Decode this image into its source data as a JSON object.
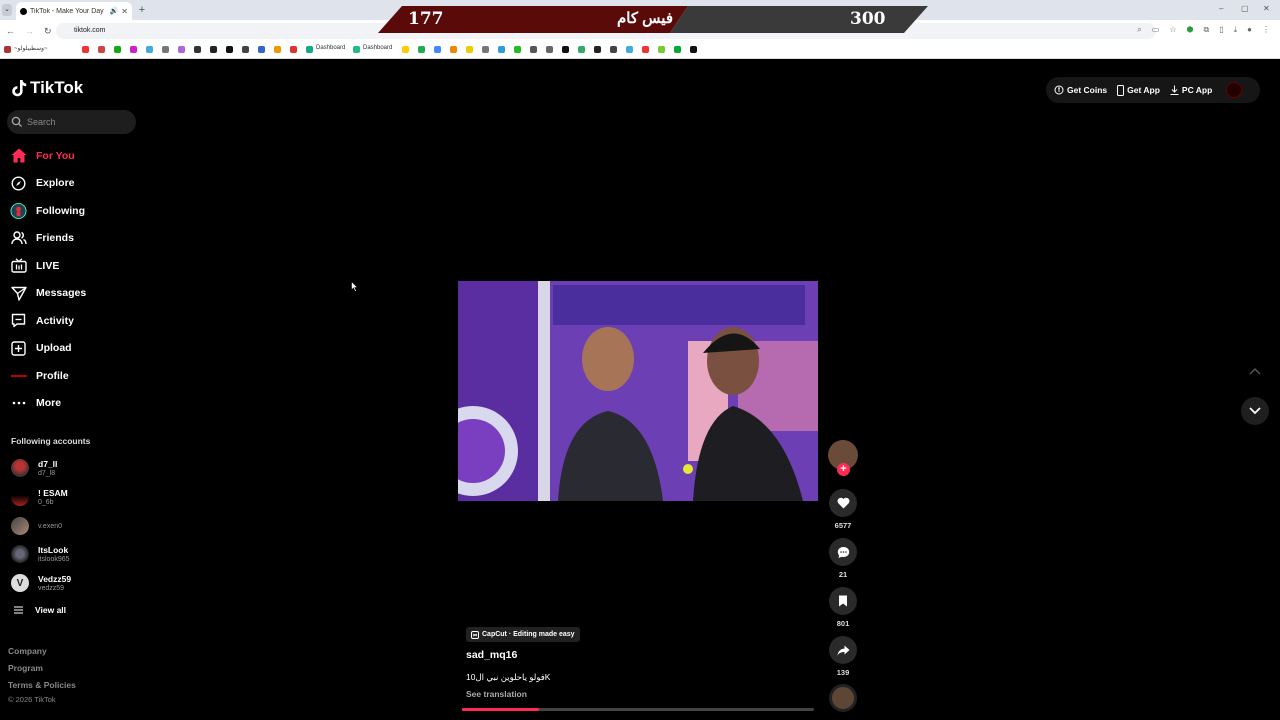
{
  "browser": {
    "tab_title": "TikTok - Make Your Day",
    "url": "tiktok.com",
    "bookmarks": {
      "first": "~وسطيبلولو~",
      "dashboard_1": "Dashboard",
      "dashboard_2": "Dashboard"
    }
  },
  "overlay": {
    "score_left": "177",
    "label": "فيس كام",
    "score_right": "300"
  },
  "app": {
    "logo": "TikTok",
    "search_placeholder": "Search",
    "nav": [
      {
        "label": "For You",
        "icon": "home-icon",
        "active": true
      },
      {
        "label": "Explore",
        "icon": "compass-icon"
      },
      {
        "label": "Following",
        "icon": "following-avatar-icon"
      },
      {
        "label": "Friends",
        "icon": "friends-icon"
      },
      {
        "label": "LIVE",
        "icon": "live-icon"
      },
      {
        "label": "Messages",
        "icon": "send-icon"
      },
      {
        "label": "Activity",
        "icon": "activity-icon"
      },
      {
        "label": "Upload",
        "icon": "plus-square-icon"
      },
      {
        "label": "Profile",
        "icon": "profile-icon"
      },
      {
        "label": "More",
        "icon": "ellipsis-icon"
      }
    ],
    "following_title": "Following accounts",
    "accounts": [
      {
        "name": "d7_ll",
        "handle": "d7_l8"
      },
      {
        "name": "! ESAM",
        "handle": "0_6b"
      },
      {
        "name": "",
        "handle": "v.exen0"
      },
      {
        "name": "ItsLook",
        "handle": "itslook965"
      },
      {
        "name": "Vedzz59",
        "handle": "vedzz59"
      }
    ],
    "view_all": "View all",
    "footer": {
      "company": "Company",
      "program": "Program",
      "terms": "Terms & Policies",
      "copyright": "© 2026 TikTok"
    },
    "top_buttons": {
      "get_coins": "Get Coins",
      "get_app": "Get App",
      "pc_app": "PC App"
    }
  },
  "video": {
    "capcut_label": "CapCut · Editing made easy",
    "author": "sad_mq16",
    "caption": "فولو ياحلوين نبي ال10K",
    "see_translation": "See translation",
    "progress": 0.22,
    "likes": "6577",
    "comments": "21",
    "saves": "801",
    "shares": "139"
  },
  "colors": {
    "accent": "#fe2c55",
    "background": "#000000",
    "overlay_left": "#5b0a0a",
    "overlay_right": "#3a3a3a"
  }
}
